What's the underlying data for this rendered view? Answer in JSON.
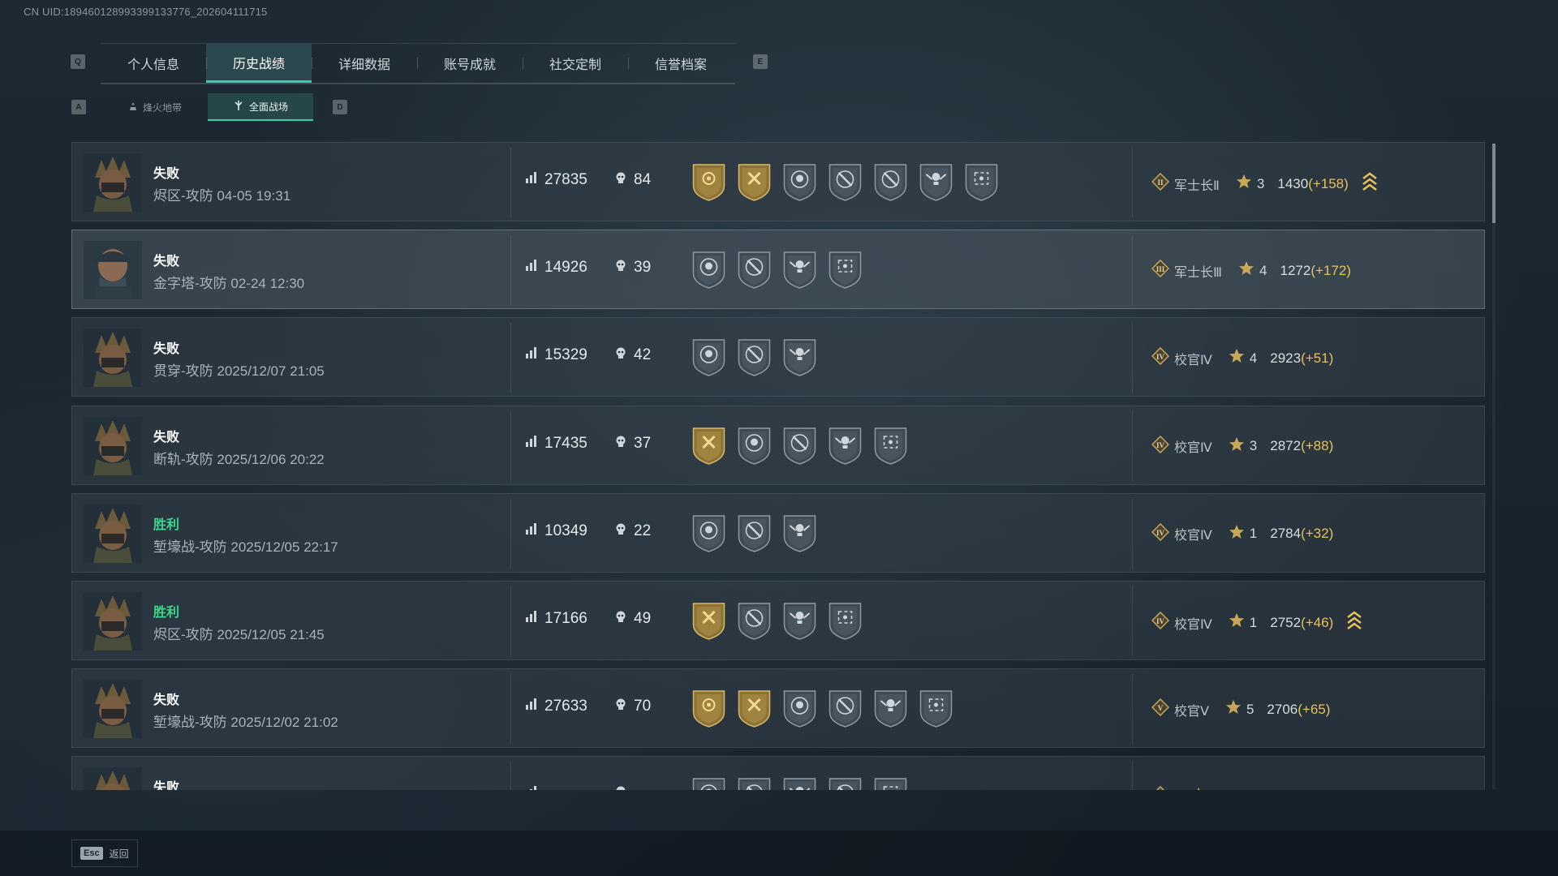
{
  "uid_text": "CN UID:1894601289933991337​76_202604111715",
  "tabs": [
    {
      "label": "个人信息",
      "active": false
    },
    {
      "label": "历史战绩",
      "active": true
    },
    {
      "label": "详细数据",
      "active": false
    },
    {
      "label": "账号成就",
      "active": false
    },
    {
      "label": "社交定制",
      "active": false
    },
    {
      "label": "信誉档案",
      "active": false
    }
  ],
  "tab_keys": {
    "left": "Q",
    "right": "E"
  },
  "subtabs": [
    {
      "label": "烽火地带",
      "active": false
    },
    {
      "label": "全面战场",
      "active": true
    }
  ],
  "subtab_keys": {
    "left": "A",
    "right": "D"
  },
  "matches": [
    {
      "result": "失败",
      "win": false,
      "map": "烬区-攻防 04-05 19:31",
      "score": "27835",
      "kills": "84",
      "medals": [
        "gold-flower",
        "gold-hammer",
        "silver-skull",
        "silver-wrench",
        "silver-wrench",
        "silver-skull-wings",
        "silver-target"
      ],
      "rank": "军士长Ⅱ",
      "rank_badge": "II",
      "stars": "3",
      "elo": "1430",
      "delta": "(+158)",
      "promo": true
    },
    {
      "result": "失败",
      "win": false,
      "map": "金字塔-攻防 02-24 12:30",
      "score": "14926",
      "kills": "39",
      "medals": [
        "silver-skull",
        "silver-wrench",
        "silver-skull-wings",
        "silver-target"
      ],
      "rank": "军士长Ⅲ",
      "rank_badge": "III",
      "stars": "4",
      "elo": "1272",
      "delta": "(+172)",
      "promo": false
    },
    {
      "result": "失败",
      "win": false,
      "map": "贯穿-攻防 2025/12/07 21:05",
      "score": "15329",
      "kills": "42",
      "medals": [
        "silver-skull",
        "silver-wrench",
        "silver-skull-wings"
      ],
      "rank": "校官Ⅳ",
      "rank_badge": "IV",
      "stars": "4",
      "elo": "2923",
      "delta": "(+51)",
      "promo": false
    },
    {
      "result": "失败",
      "win": false,
      "map": "断轨-攻防 2025/12/06 20:22",
      "score": "17435",
      "kills": "37",
      "medals": [
        "gold-hammer",
        "silver-skull",
        "silver-wrench",
        "silver-skull-wings",
        "silver-target"
      ],
      "rank": "校官Ⅳ",
      "rank_badge": "IV",
      "stars": "3",
      "elo": "2872",
      "delta": "(+88)",
      "promo": false
    },
    {
      "result": "胜利",
      "win": true,
      "map": "堑壕战-攻防 2025/12/05 22:17",
      "score": "10349",
      "kills": "22",
      "medals": [
        "silver-skull",
        "silver-wrench",
        "silver-skull-wings"
      ],
      "rank": "校官Ⅳ",
      "rank_badge": "IV",
      "stars": "1",
      "elo": "2784",
      "delta": "(+32)",
      "promo": false
    },
    {
      "result": "胜利",
      "win": true,
      "map": "烬区-攻防 2025/12/05 21:45",
      "score": "17166",
      "kills": "49",
      "medals": [
        "gold-hammer",
        "silver-wrench",
        "silver-skull-wings",
        "silver-target"
      ],
      "rank": "校官Ⅳ",
      "rank_badge": "IV",
      "stars": "1",
      "elo": "2752",
      "delta": "(+46)",
      "promo": true
    },
    {
      "result": "失败",
      "win": false,
      "map": "堑壕战-攻防 2025/12/02 21:02",
      "score": "27633",
      "kills": "70",
      "medals": [
        "gold-flower",
        "gold-hammer",
        "silver-skull",
        "silver-wrench",
        "silver-skull-wings",
        "silver-target"
      ],
      "rank": "校官Ⅴ",
      "rank_badge": "V",
      "stars": "5",
      "elo": "2706",
      "delta": "(+65)",
      "promo": false
    },
    {
      "result": "失败",
      "win": false,
      "map": "",
      "score": "",
      "kills": "",
      "medals": [
        "silver-skull",
        "silver-wrench",
        "silver-skull-wings",
        "silver-wrench",
        "silver-target"
      ],
      "rank": "",
      "rank_badge": "IV",
      "stars": "",
      "elo": "",
      "delta": "",
      "promo": false
    }
  ],
  "footer": {
    "key": "Esc",
    "label": "返回"
  },
  "colors": {
    "accent": "#2fd1b0",
    "win": "#39d98a",
    "gold": "#e8c15a"
  }
}
